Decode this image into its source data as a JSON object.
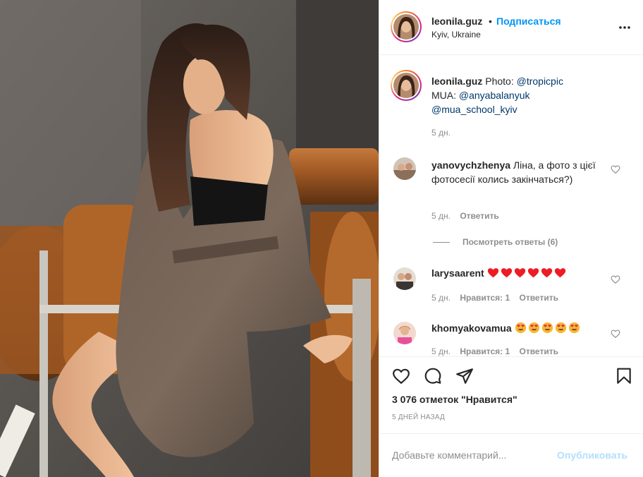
{
  "post": {
    "username": "leonila.guz",
    "separator": "•",
    "follow_label": "Подписаться",
    "location": "Kyiv, Ukraine",
    "more_icon": "more-horizontal-icon"
  },
  "caption": {
    "username": "leonila.guz",
    "photo_prefix": "Photo: ",
    "photo_credit": "@tropicpic",
    "mua_prefix": "MUA: ",
    "mua_credit": "@anyabalanyuk",
    "school_credit": "@mua_school_kyiv",
    "time": "5 дн."
  },
  "comments": [
    {
      "username": "yanovychzhenya",
      "text": "Ліна, а фото з цієї фотосесії колись закінчаться?)",
      "time": "5 дн.",
      "reply_label": "Ответить",
      "view_replies": "Посмотреть ответы (6)"
    },
    {
      "username": "larysaarent",
      "emoji_icon": "red-heart",
      "emoji_count": 6,
      "time": "5 дн.",
      "likes": "Нравится: 1",
      "reply_label": "Ответить"
    },
    {
      "username": "khomyakovamua",
      "emoji_icon": "heart-eyes-face",
      "emoji_count": 5,
      "time": "5 дн.",
      "likes": "Нравится: 1",
      "reply_label": "Ответить"
    }
  ],
  "actions": {
    "like_icon": "heart-outline-icon",
    "comment_icon": "comment-bubble-icon",
    "share_icon": "paper-plane-icon",
    "save_icon": "bookmark-icon",
    "likes_count": "3 076 отметок \"Нравится\"",
    "posted_when": "5 ДНЕЙ НАЗАД"
  },
  "add_comment": {
    "placeholder": "Добавьте комментарий...",
    "post_label": "Опубликовать"
  },
  "colors": {
    "accent": "#0095f6",
    "mention": "#00376b",
    "muted": "#8e8e8e",
    "disabled_post": "#b2dffc",
    "heart_red": "#ed1c24"
  }
}
